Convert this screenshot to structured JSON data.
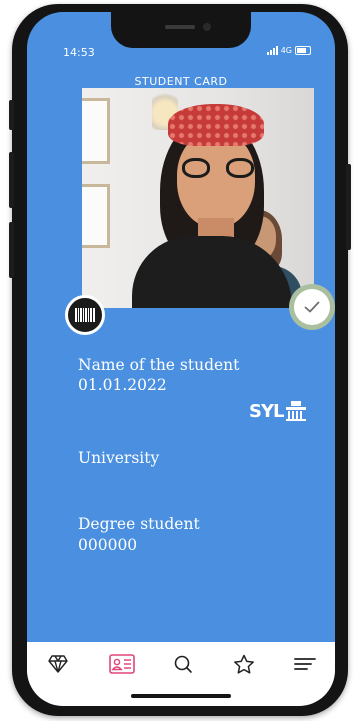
{
  "status_bar": {
    "time": "14:53",
    "network": "4G"
  },
  "card": {
    "title": "STUDENT CARD",
    "student_name": "Name of the student",
    "date": "01.01.2022",
    "university": "University",
    "degree": "Degree student",
    "student_number": "000000",
    "logo_text": "SYL"
  },
  "colors": {
    "card_background": "#4a8fe0",
    "accent": "#e0457b",
    "verified_ring": "#a9bfa0"
  },
  "bottom_nav": {
    "items": [
      {
        "icon": "diamond-icon",
        "active": false
      },
      {
        "icon": "id-card-icon",
        "active": true
      },
      {
        "icon": "search-icon",
        "active": false
      },
      {
        "icon": "star-icon",
        "active": false
      },
      {
        "icon": "menu-icon",
        "active": false
      }
    ]
  }
}
